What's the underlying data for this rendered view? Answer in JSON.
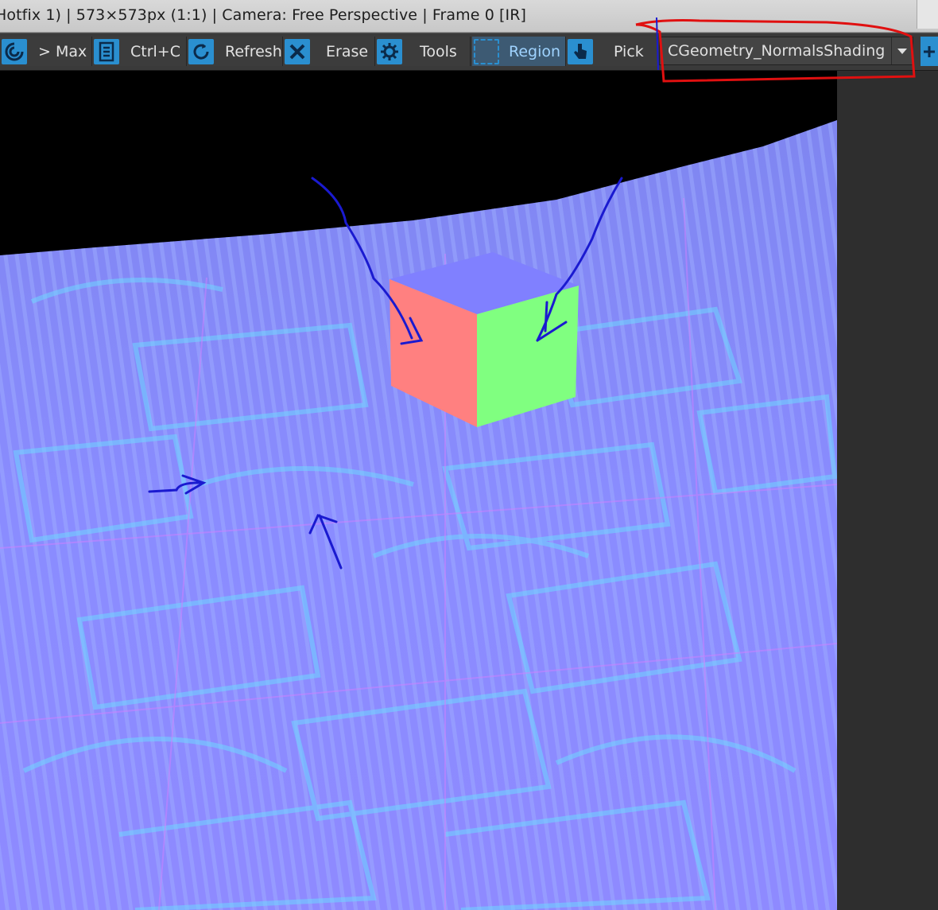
{
  "window": {
    "title": "Hotfix 1) | 573×573px (1:1) | Camera: Free Perspective | Frame 0 [IR]"
  },
  "toolbar": {
    "buttons": [
      {
        "label": "> Max",
        "icon": "vray-logo-icon"
      },
      {
        "label": "Ctrl+C",
        "icon": "copy-icon"
      },
      {
        "label": "Refresh",
        "icon": "refresh-icon"
      },
      {
        "label": "Erase",
        "icon": "erase-icon"
      },
      {
        "label": "Tools",
        "icon": "gear-icon"
      },
      {
        "label": "Region",
        "icon": "region-icon",
        "active": true
      },
      {
        "label": "Pick",
        "icon": "pick-hand-icon"
      }
    ],
    "render_element_select": {
      "value": "CGeometry_NormalsShading"
    }
  },
  "colors": {
    "toolbar_bg": "#3a3a3a",
    "icon_blue": "#2a8fd0",
    "active_bg": "#3d5a73",
    "cube_top": "#8080ff",
    "cube_left": "#ff8080",
    "cube_right": "#80ff80",
    "ground": "#8a8aff",
    "annotation_red": "#e01010",
    "annotation_blue": "#1a1ad0"
  }
}
